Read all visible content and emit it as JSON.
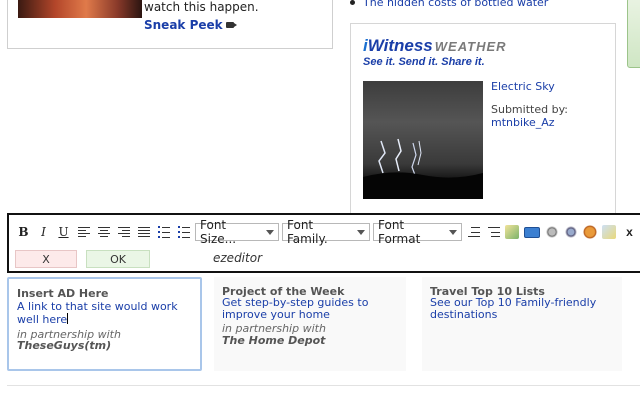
{
  "story": {
    "text": "watch this happen.",
    "sneak_peek": "Sneak Peek",
    "camera_icon": "video-camera-icon"
  },
  "bullet": {
    "link": "The hidden costs of bottled water"
  },
  "iwitness": {
    "logo_i": "i",
    "logo_witness": "Witness",
    "logo_weather": "WEATHER",
    "tagline": "See it. Send it. Share it.",
    "title": "Electric Sky",
    "submitted_by": "Submitted by:",
    "user": "mtnbike_Az"
  },
  "editor": {
    "name": "ezeditor",
    "font_size_label": "Font Size...",
    "font_family_label": "Font Family.",
    "font_format_label": "Font Format",
    "cancel_label": "X",
    "ok_label": "OK",
    "colors": {
      "cancel_bg": "#fdeaea",
      "ok_bg": "#eaf6e6",
      "frame": "#111111"
    }
  },
  "promos": [
    {
      "title": "Insert AD Here",
      "link": "A link to that site would work well here",
      "partner": "in partnership with",
      "partner_name": "TheseGuys(tm)"
    },
    {
      "title": "Project of the Week",
      "link": "Get step-by-step guides to improve your home",
      "partner": "in partnership with",
      "partner_name": "The Home Depot"
    },
    {
      "title": "Travel Top 10 Lists",
      "link": "See our Top 10 Family-friendly destinations",
      "partner": "",
      "partner_name": ""
    }
  ]
}
